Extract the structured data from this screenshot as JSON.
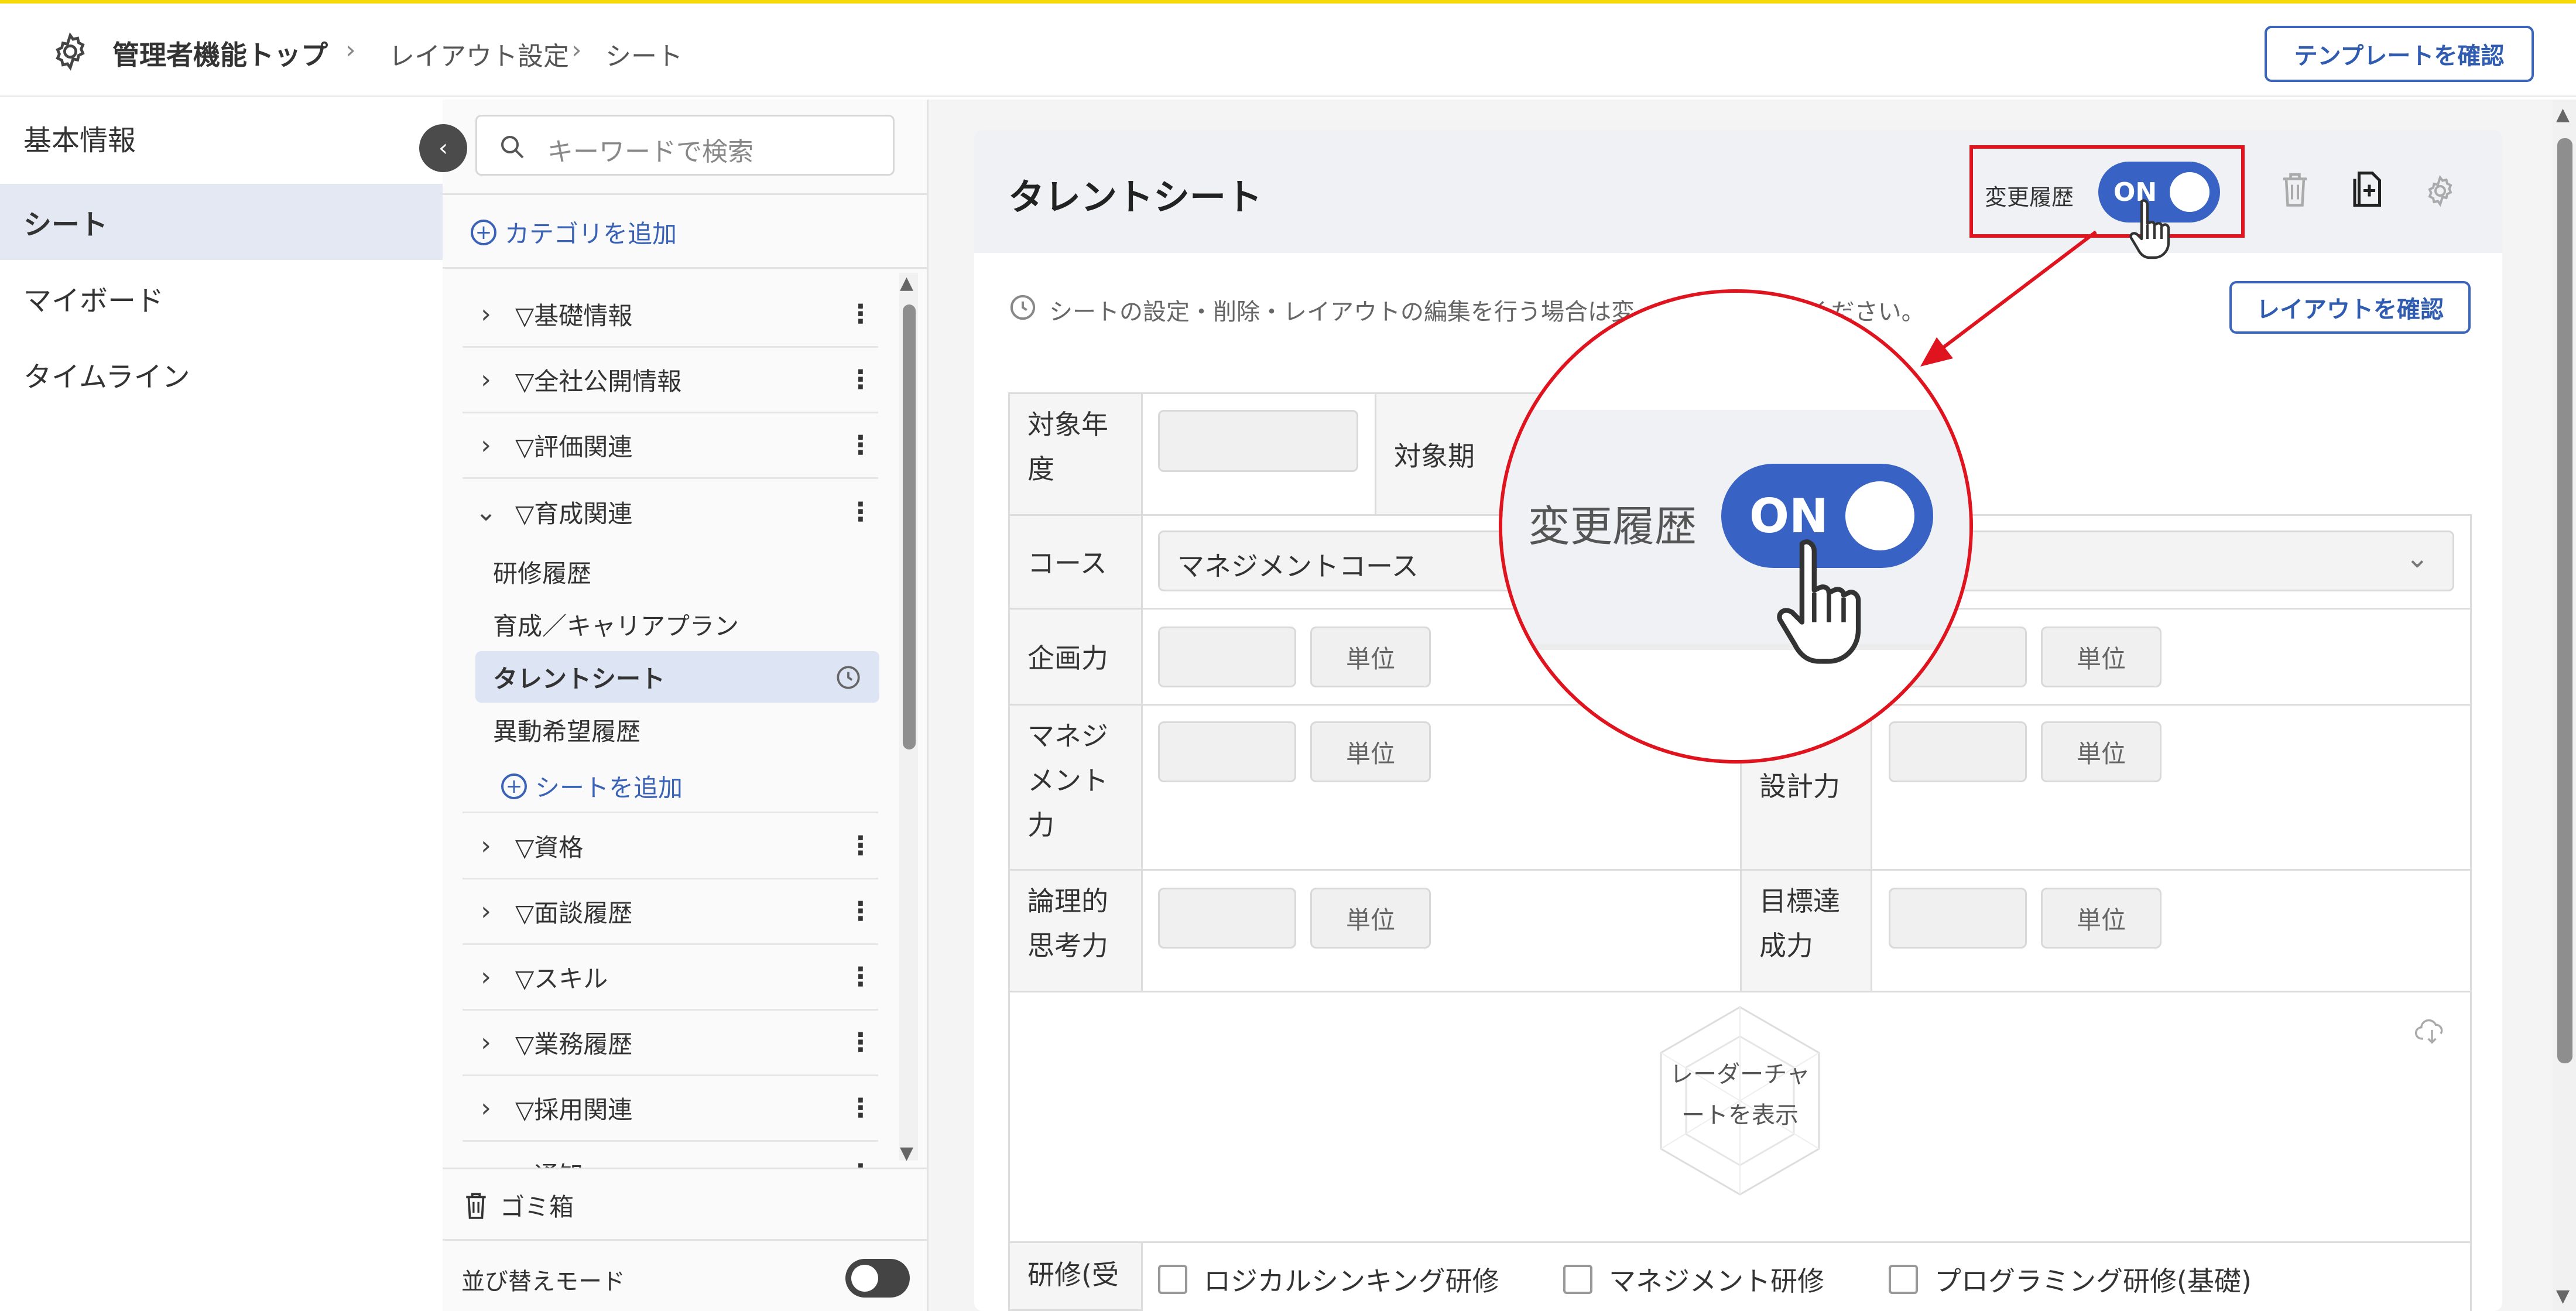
{
  "header": {
    "title": "管理者機能トップ",
    "breadcrumb": [
      "レイアウト設定",
      "シート"
    ],
    "template_button": "テンプレートを確認"
  },
  "leftnav": {
    "items": [
      {
        "label": "基本情報"
      },
      {
        "label": "シート"
      },
      {
        "label": "マイボード"
      },
      {
        "label": "タイムライン"
      }
    ]
  },
  "tree": {
    "search_placeholder": "キーワードで検索",
    "add_category": "カテゴリを追加",
    "categories": [
      {
        "label": "▽基礎情報"
      },
      {
        "label": "▽全社公開情報"
      },
      {
        "label": "▽評価関連"
      },
      {
        "label": "▽育成関連"
      }
    ],
    "children": [
      "研修履歴",
      "育成／キャリアプラン",
      "タレントシート",
      "異動希望履歴"
    ],
    "add_sheet": "シートを追加",
    "categories_after": [
      {
        "label": "▽資格"
      },
      {
        "label": "▽面談履歴"
      },
      {
        "label": "▽スキル"
      },
      {
        "label": "▽業務履歴"
      },
      {
        "label": "▽採用関連"
      },
      {
        "label": "▽通知"
      }
    ],
    "trash": "ゴミ箱",
    "sort_mode": "並び替えモード"
  },
  "sheet": {
    "title": "タレントシート",
    "history_label": "変更履歴",
    "toggle_state": "ON",
    "notice": "シートの設定・削除・レイアウトの編集を行う場合は変更履歴をOFFにしてください。",
    "notice_visible": "シートの設定・削除・レイアウトの編集を行う場合は変",
    "notice_tail": "してください。",
    "layout_button": "レイアウトを確認",
    "fields": {
      "target_year": "対象年度",
      "target_period": "対象期",
      "course": "コース",
      "course_value": "マネジメントコース",
      "planning": "企画力",
      "management": "マネジメント力",
      "design": "設計力",
      "logical": "論理的思考力",
      "goal": "目標達成力",
      "unit": "単位"
    },
    "radar": "レーダーチャートを表示",
    "training_label": "研修(受",
    "trainings": [
      "ロジカルシンキング研修",
      "マネジメント研修",
      "プログラミング研修(基礎)"
    ]
  },
  "zoom": {
    "history_label": "変更履歴",
    "toggle_state": "ON"
  },
  "colors": {
    "accent": "#3862c3",
    "highlight": "#e0141e",
    "topline": "#f5d90a"
  }
}
